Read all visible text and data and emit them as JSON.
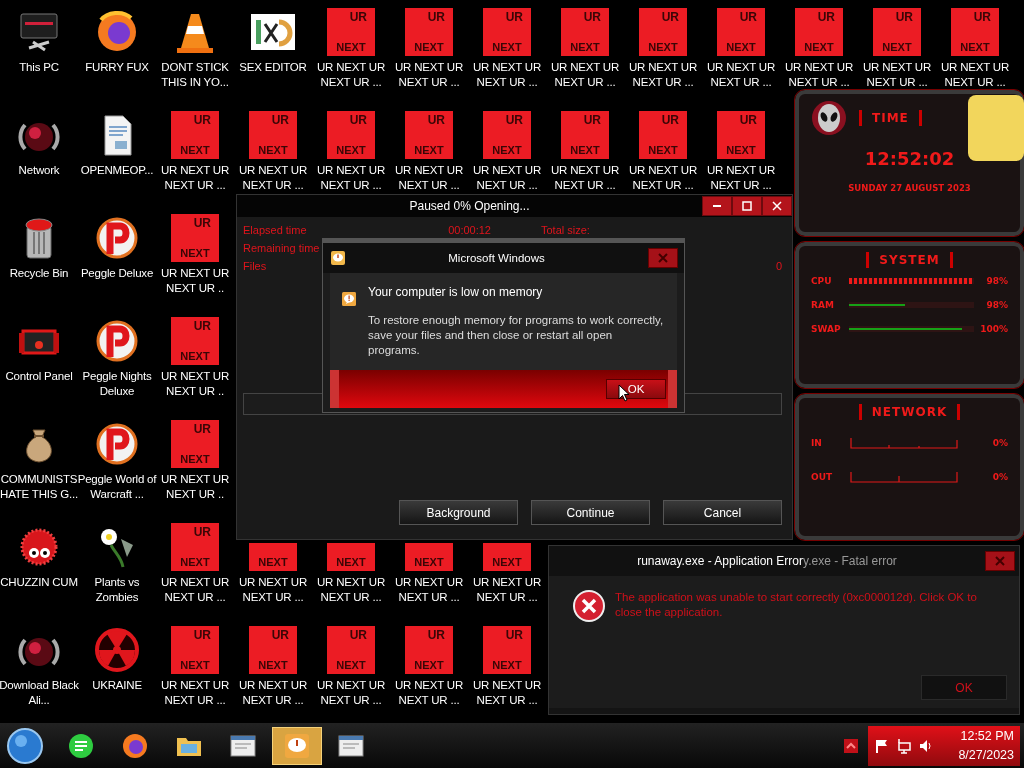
{
  "desktop": {
    "columns": [
      [
        {
          "kind": "pc",
          "label": "This PC"
        },
        {
          "kind": "orb",
          "label": "Network"
        },
        {
          "kind": "bin",
          "label": "Recycle Bin"
        },
        {
          "kind": "device",
          "label": "Control Panel"
        },
        {
          "kind": "money",
          "label": "COMMUNISTS HATE THIS G..."
        },
        {
          "kind": "furball",
          "label": "CHUZZIN CUM"
        },
        {
          "kind": "orb",
          "label": "Download Black Ali..."
        }
      ],
      [
        {
          "kind": "browser",
          "label": "FURRY FUX"
        },
        {
          "kind": "document",
          "label": "OPENMEOP..."
        },
        {
          "kind": "ball",
          "label": "Peggle Deluxe"
        },
        {
          "kind": "ball",
          "label": "Peggle Nights Deluxe"
        },
        {
          "kind": "ball",
          "label": "Peggle World of Warcraft ..."
        },
        {
          "kind": "flower",
          "label": "Plants vs Zombies"
        },
        {
          "kind": "radiation",
          "label": "UKRAINE"
        }
      ],
      [
        {
          "kind": "cone",
          "label": "DONT STICK THIS IN YO..."
        },
        {
          "kind": "tile",
          "top": "UR",
          "bottom": "NEXT",
          "label": "UR NEXT UR NEXT UR ..."
        },
        {
          "kind": "tile",
          "top": "UR",
          "bottom": "NEXT",
          "label": "UR NEXT UR NEXT UR .."
        },
        {
          "kind": "tile",
          "top": "UR",
          "bottom": "NEXT",
          "label": "UR NEXT UR NEXT UR .."
        },
        {
          "kind": "tile",
          "top": "UR",
          "bottom": "NEXT",
          "label": "UR NEXT UR NEXT UR .."
        },
        {
          "kind": "tile",
          "top": "UR",
          "bottom": "NEXT",
          "label": "UR NEXT UR NEXT UR ..."
        },
        {
          "kind": "tile",
          "top": "UR",
          "bottom": "NEXT",
          "label": "UR NEXT UR NEXT UR ..."
        }
      ],
      [
        {
          "kind": "hexlogo",
          "label": "SEX EDITOR"
        },
        {
          "kind": "tile",
          "top": "UR",
          "bottom": "NEXT",
          "label": "UR NEXT UR NEXT UR ..."
        },
        null,
        null,
        null,
        {
          "kind": "tile",
          "bottom": "NEXT",
          "label": "UR NEXT UR NEXT UR ..."
        },
        {
          "kind": "tile",
          "top": "UR",
          "bottom": "NEXT",
          "label": "UR NEXT UR NEXT UR ..."
        }
      ],
      [
        {
          "kind": "tile",
          "top": "UR",
          "bottom": "NEXT",
          "label": "UR NEXT UR NEXT UR ..."
        },
        {
          "kind": "tile",
          "top": "UR",
          "bottom": "NEXT",
          "label": "UR NEXT UR NEXT UR ..."
        },
        null,
        null,
        null,
        {
          "kind": "tile",
          "bottom": "NEXT",
          "label": "UR NEXT UR NEXT UR ..."
        },
        {
          "kind": "tile",
          "top": "UR",
          "bottom": "NEXT",
          "label": "UR NEXT UR NEXT UR ..."
        }
      ],
      [
        {
          "kind": "tile",
          "top": "UR",
          "bottom": "NEXT",
          "label": "UR NEXT UR NEXT UR ..."
        },
        {
          "kind": "tile",
          "top": "UR",
          "bottom": "NEXT",
          "label": "UR NEXT UR NEXT UR ..."
        },
        null,
        null,
        null,
        {
          "kind": "tile",
          "bottom": "NEXT",
          "label": "UR NEXT UR NEXT UR ..."
        },
        {
          "kind": "tile",
          "top": "UR",
          "bottom": "NEXT",
          "label": "UR NEXT UR NEXT UR ..."
        }
      ],
      [
        {
          "kind": "tile",
          "top": "UR",
          "bottom": "NEXT",
          "label": "UR NEXT UR NEXT UR ..."
        },
        {
          "kind": "tile",
          "top": "UR",
          "bottom": "NEXT",
          "label": "UR NEXT UR NEXT UR ..."
        },
        null,
        null,
        null,
        {
          "kind": "tile",
          "bottom": "NEXT",
          "label": "UR NEXT UR NEXT UR ..."
        },
        {
          "kind": "tile",
          "top": "UR",
          "bottom": "NEXT",
          "label": "UR NEXT UR NEXT UR ..."
        }
      ],
      [
        {
          "kind": "tile",
          "top": "UR",
          "bottom": "NEXT",
          "label": "UR NEXT UR NEXT UR ..."
        },
        {
          "kind": "tile",
          "top": "UR",
          "bottom": "NEXT",
          "label": "UR NEXT UR NEXT UR ..."
        }
      ],
      [
        {
          "kind": "tile",
          "top": "UR",
          "bottom": "NEXT",
          "label": "UR NEXT UR NEXT UR ..."
        },
        {
          "kind": "tile",
          "top": "UR",
          "bottom": "NEXT",
          "label": "UR NEXT UR NEXT UR ..."
        }
      ],
      [
        {
          "kind": "tile",
          "top": "UR",
          "bottom": "NEXT",
          "label": "UR NEXT UR NEXT UR ..."
        },
        {
          "kind": "tile",
          "top": "UR",
          "bottom": "NEXT",
          "label": "UR NEXT UR NEXT UR ..."
        }
      ],
      [
        {
          "kind": "tile",
          "top": "UR",
          "bottom": "NEXT",
          "label": "UR NEXT UR NEXT UR ..."
        }
      ],
      [
        {
          "kind": "tile",
          "top": "UR",
          "bottom": "NEXT",
          "label": "UR NEXT UR NEXT UR ..."
        }
      ],
      [
        {
          "kind": "tile",
          "top": "UR",
          "bottom": "NEXT",
          "label": "UR NEXT UR NEXT UR ..."
        }
      ]
    ]
  },
  "progress_window": {
    "title": "Paused 0% Opening...",
    "stats": [
      {
        "label": "Elapsed time",
        "value": "00:00:12",
        "label2": "Total size:"
      },
      {
        "label": "Remaining time"
      },
      {
        "label": "Files",
        "value2": "0"
      }
    ],
    "progress": {
      "level": 0
    },
    "buttons": [
      "Background",
      "Continue",
      "Cancel"
    ]
  },
  "dialog": {
    "title": "Microsoft Windows",
    "heading": "Your computer is low on memory",
    "body": "To restore enough memory for programs to work correctly, save your files and then close or restart all open programs.",
    "button": "OK"
  },
  "error_window": {
    "title": "runaway.exe - Application Error",
    "title_behind": "y.exe - Fatal error",
    "message": "The application was unable to start correctly (0xc000012d). Click OK to close the application.",
    "button": "OK"
  },
  "gadget": {
    "time_title": "TIME",
    "time": "12:52:02",
    "date": "SUNDAY 27 AUGUST 2023",
    "system_title": "SYSTEM",
    "meters": [
      {
        "name": "CPU",
        "kind": "chevrons",
        "level": 0.98,
        "reading": "98%"
      },
      {
        "name": "RAM",
        "kind": "line",
        "level": 0.45,
        "reading": "98%"
      },
      {
        "name": "SWAP",
        "kind": "line",
        "level": 0.9,
        "reading": "100%"
      }
    ],
    "network_title": "NETWORK",
    "network": [
      {
        "name": "IN",
        "reading": "0%"
      },
      {
        "name": "OUT",
        "reading": "0%"
      }
    ]
  },
  "taskbar": {
    "items": [
      {
        "kind": "chat",
        "selected": false
      },
      {
        "kind": "browser",
        "selected": false
      },
      {
        "kind": "folder",
        "selected": false
      },
      {
        "kind": "window",
        "selected": false
      },
      {
        "kind": "warning",
        "selected": true
      },
      {
        "kind": "window",
        "selected": false
      }
    ],
    "time": "12:52 PM",
    "date": "8/27/2023"
  }
}
